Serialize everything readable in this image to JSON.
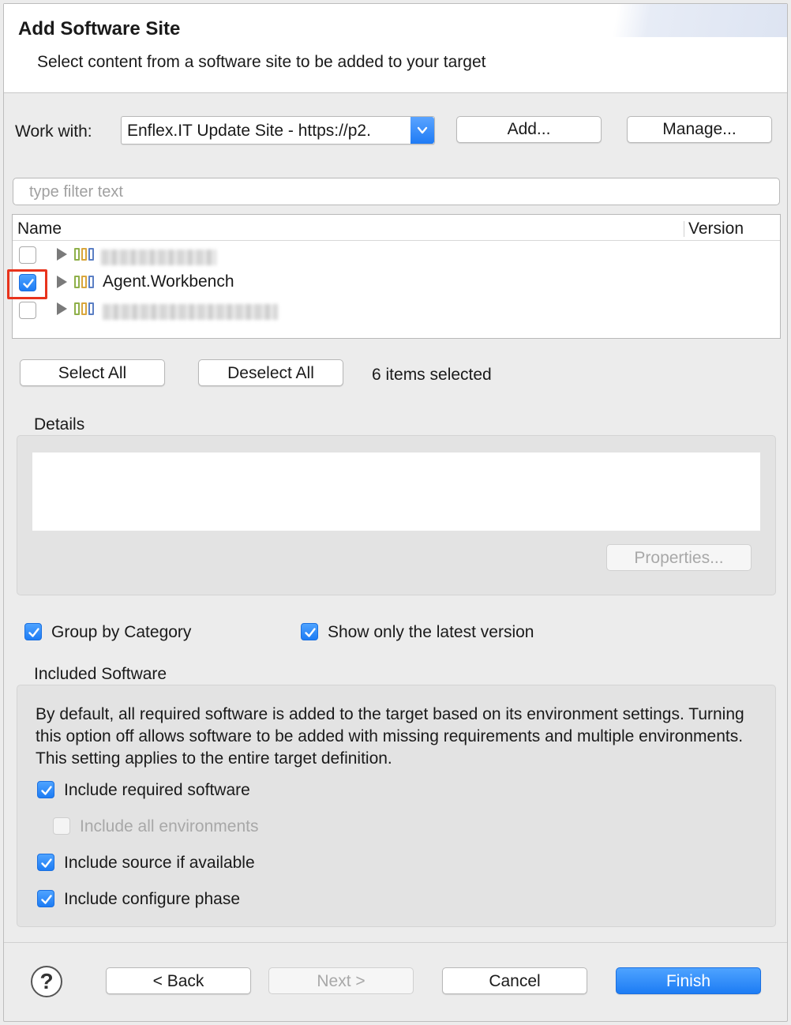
{
  "dialog": {
    "title": "Add Software Site",
    "subtitle": "Select content from a software site to be added to your target"
  },
  "work_with": {
    "label": "Work with:",
    "value": "Enflex.IT Update Site - https://p2.",
    "add_label": "Add...",
    "manage_label": "Manage..."
  },
  "filter": {
    "placeholder": "type filter text"
  },
  "tree": {
    "columns": [
      "Name",
      "Version"
    ],
    "rows": [
      {
        "label": "",
        "checked": false,
        "blurred": true
      },
      {
        "label": "Agent.Workbench",
        "checked": true,
        "blurred": false
      },
      {
        "label": "",
        "checked": false,
        "blurred": true
      }
    ]
  },
  "selection": {
    "select_all": "Select All",
    "deselect_all": "Deselect All",
    "status": "6 items selected"
  },
  "details": {
    "label": "Details",
    "properties_label": "Properties..."
  },
  "options": {
    "group_by_category": {
      "label": "Group by Category",
      "checked": true
    },
    "show_latest": {
      "label": "Show only the latest version",
      "checked": true
    }
  },
  "included": {
    "label": "Included Software",
    "description": "By default, all required software is added to the target based on its environment settings. Turning this option off allows software to be added with missing requirements and multiple environments.  This setting applies to the entire target definition.",
    "include_required": {
      "label": "Include required software",
      "checked": true
    },
    "include_all_env": {
      "label": "Include all environments",
      "checked": false,
      "enabled": false
    },
    "include_source": {
      "label": "Include source if available",
      "checked": true
    },
    "include_configure": {
      "label": "Include configure phase",
      "checked": true
    }
  },
  "footer": {
    "help": "?",
    "back": "< Back",
    "next": "Next >",
    "cancel": "Cancel",
    "finish": "Finish"
  },
  "colors": {
    "accent": "#1d7cf4",
    "highlight": "#e8331c"
  }
}
